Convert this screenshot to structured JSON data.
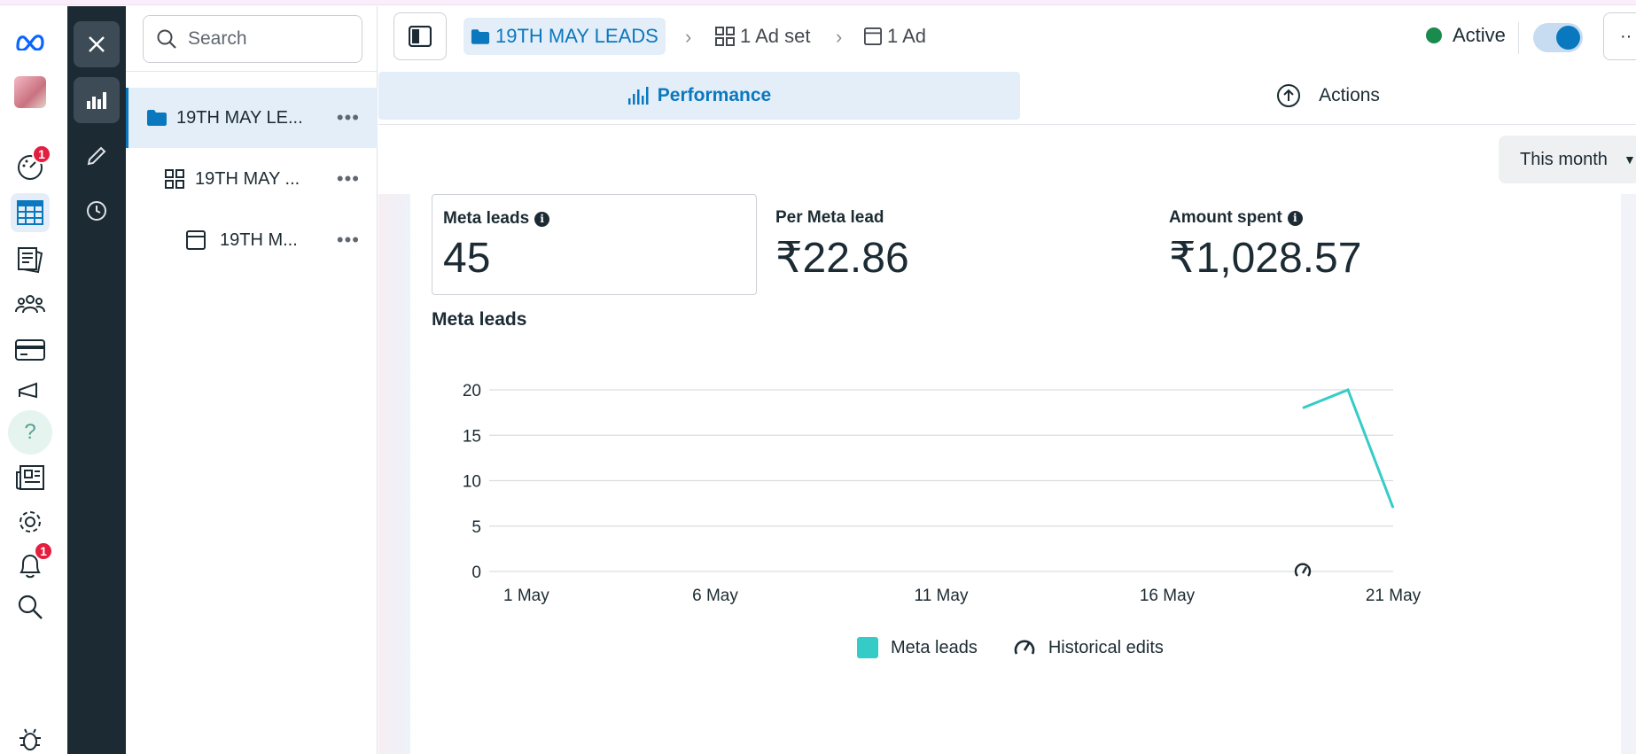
{
  "rail": {
    "badges": {
      "insights": "1",
      "notifications": "1"
    }
  },
  "tree": {
    "search_placeholder": "Search",
    "campaign": "19TH MAY LE...",
    "adset": "19TH MAY ...",
    "ad": "19TH M...",
    "more": "•••"
  },
  "topbar": {
    "campaign_crumb": "19TH MAY LEADS",
    "adset_crumb": "1 Ad set",
    "ad_crumb": "1 Ad",
    "status": "Active",
    "toggle_on": true,
    "more": "··"
  },
  "tabs": {
    "performance": "Performance",
    "actions": "Actions"
  },
  "date_range": "This month",
  "metrics": [
    {
      "label": "Meta leads",
      "value": "45",
      "info": true
    },
    {
      "label": "Per Meta lead",
      "value": "₹22.86",
      "info": false
    },
    {
      "label": "Amount spent",
      "value": "₹1,028.57",
      "info": true
    }
  ],
  "chart_title": "Meta leads",
  "chart_data": {
    "type": "line",
    "title": "Meta leads",
    "x_ticks": [
      "1 May",
      "6 May",
      "11 May",
      "16 May",
      "21 May"
    ],
    "y_ticks": [
      "0",
      "5",
      "10",
      "15",
      "20"
    ],
    "ylim": [
      0,
      20
    ],
    "x_range_days": [
      1,
      21
    ],
    "series": [
      {
        "name": "Meta leads",
        "color": "#35ccc8",
        "x": [
          19,
          20,
          21
        ],
        "y": [
          18,
          20,
          7
        ]
      }
    ],
    "historical_edit_markers": [
      19
    ],
    "legend": [
      {
        "name": "Meta leads",
        "kind": "swatch"
      },
      {
        "name": "Historical edits",
        "kind": "icon"
      }
    ],
    "legend_position": "bottom"
  }
}
